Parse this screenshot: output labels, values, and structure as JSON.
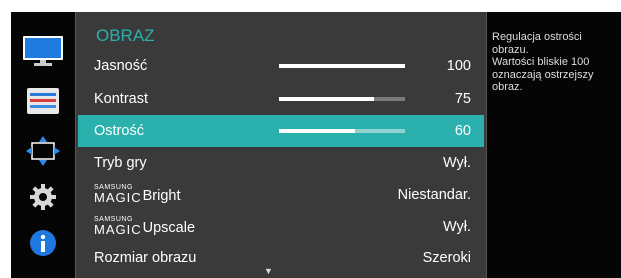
{
  "menu": {
    "title": "OBRAZ",
    "more_arrow": "▼",
    "items": [
      {
        "label": "Jasność",
        "value": "100",
        "level": 1.0
      },
      {
        "label": "Kontrast",
        "value": "75",
        "level": 0.75
      },
      {
        "label": "Ostrość",
        "value": "60",
        "level": 0.6,
        "selected": true
      },
      {
        "label": "Tryb gry",
        "value": "Wył."
      },
      {
        "label_prefix_top": "SAMSUNG",
        "label_prefix_bottom": "MAGIC",
        "label": "Bright",
        "value": "Niestandar."
      },
      {
        "label_prefix_top": "SAMSUNG",
        "label_prefix_bottom": "MAGIC",
        "label": "Upscale",
        "value": "Wył."
      },
      {
        "label": "Rozmiar obrazu",
        "value": "Szeroki"
      }
    ]
  },
  "sidebar_icons": [
    "picture-icon",
    "color-icon",
    "size-position-icon",
    "setup-gear-icon",
    "information-icon"
  ],
  "description": {
    "text": "Regulacja ostrości\nobrazu.\nWartości bliskie 100\noznaczają ostrzejszy\nobraz."
  },
  "colors": {
    "accent": "#2ab1ad",
    "menu_bg": "#3a3a3a",
    "osd_bg": "#050505",
    "info_blue": "#1f78e0"
  }
}
